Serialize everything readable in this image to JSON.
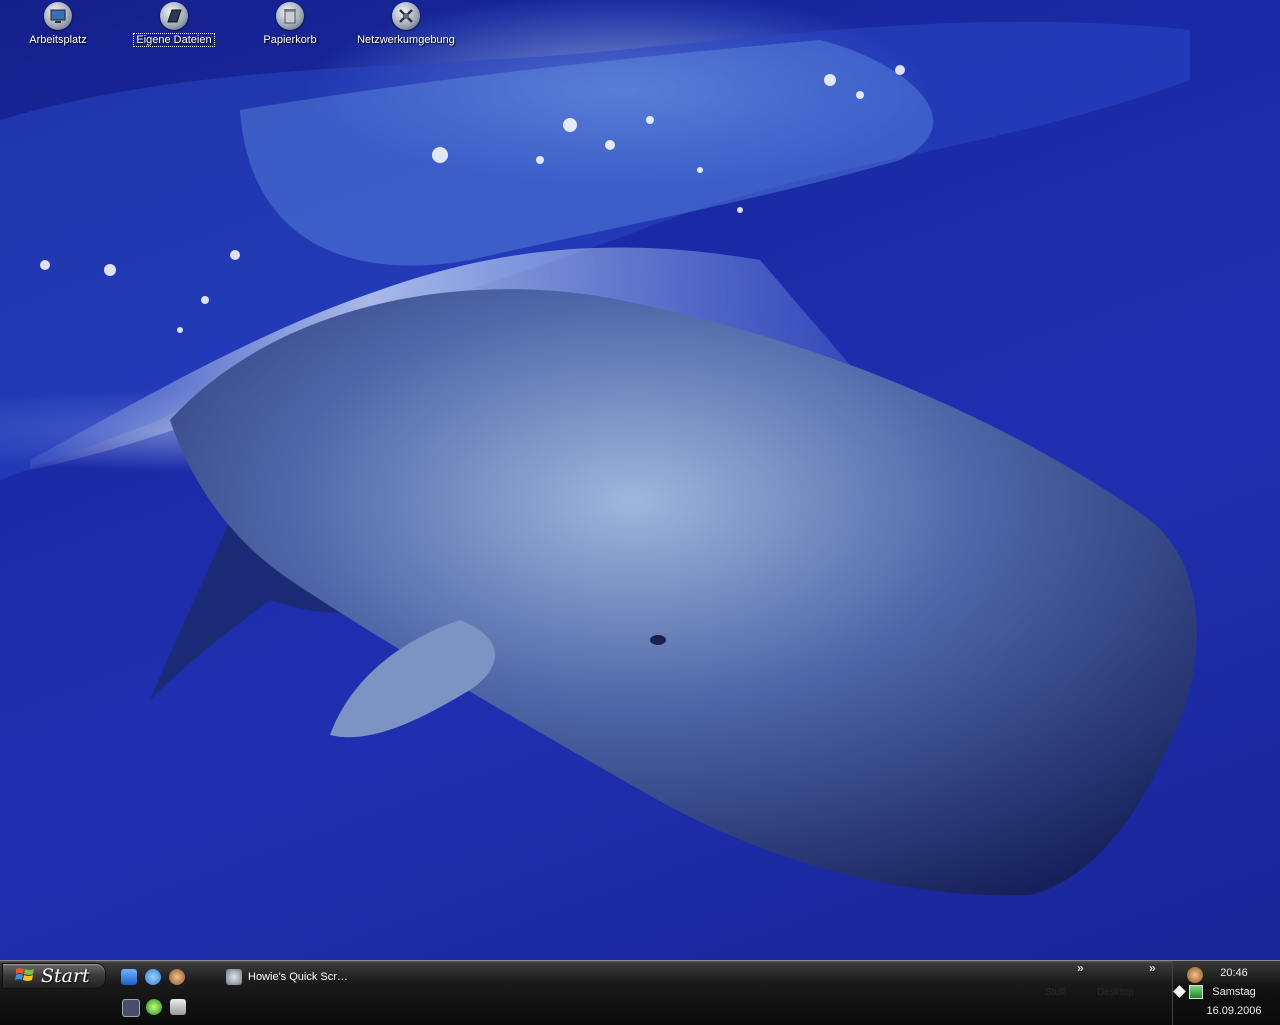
{
  "desktop": {
    "icons": [
      {
        "label": "Arbeitsplatz",
        "icon": "my-computer-icon"
      },
      {
        "label": "Eigene Dateien",
        "icon": "my-documents-icon",
        "selected": true
      },
      {
        "label": "Papierkorb",
        "icon": "recycle-bin-icon"
      },
      {
        "label": "Netzwerkumgebung",
        "icon": "network-places-icon"
      }
    ]
  },
  "taskbar": {
    "start_label": "Start",
    "quick_launch": [
      {
        "name": "outlook-express-icon"
      },
      {
        "name": "internet-explorer-icon"
      },
      {
        "name": "monkey-app-icon"
      }
    ],
    "quick_launch_row2": [
      {
        "name": "headset-icon"
      },
      {
        "name": "green-flower-icon"
      },
      {
        "name": "network-card-icon"
      }
    ],
    "task": {
      "label": "Howie's Quick Scr…",
      "icon": "screenshot-tool-icon"
    },
    "toolbars": [
      {
        "label": "Stuff"
      },
      {
        "label": "Desktop"
      }
    ],
    "chevron": "»"
  },
  "tray": {
    "time": "20:46",
    "day": "Samstag",
    "date": "16.09.2006",
    "icons": [
      "monkey-tray-icon",
      "diamond-tray-icon",
      "green-notepad-tray-icon"
    ]
  },
  "colors": {
    "desktop_blue": "#1f2fb0",
    "taskbar_black": "#0a0a0a"
  }
}
